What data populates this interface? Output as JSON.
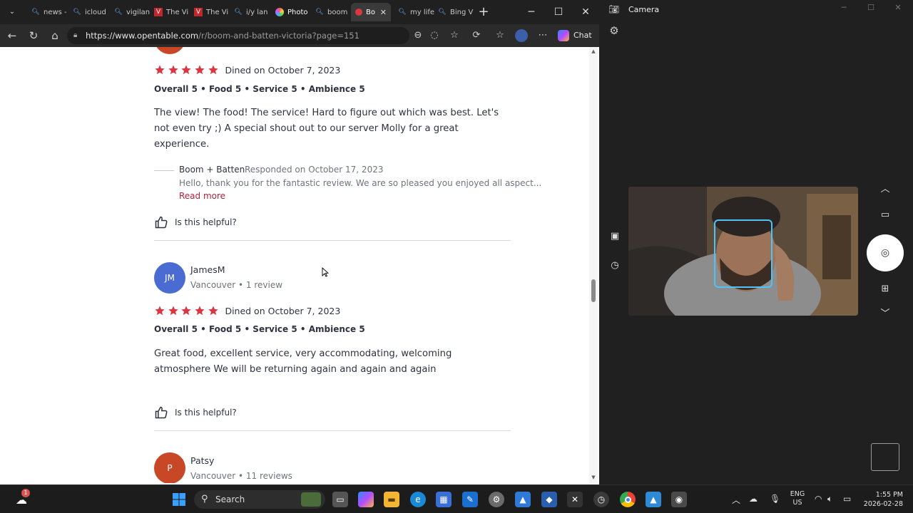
{
  "browser": {
    "tabs": [
      {
        "label": "news -"
      },
      {
        "label": "icloud"
      },
      {
        "label": "vigilan"
      },
      {
        "label": "The Vi"
      },
      {
        "label": "The Vi"
      },
      {
        "label": "i/y lan"
      },
      {
        "label": "Photo"
      },
      {
        "label": "boom"
      },
      {
        "label": "Bo",
        "active": true
      },
      {
        "label": "my life"
      },
      {
        "label": "Bing V"
      }
    ],
    "new_tab": "+",
    "url_host": "https://www.opentable.com",
    "url_path": "/r/boom-and-batten-victoria?page=151",
    "chat_label": "Chat"
  },
  "reviews": [
    {
      "dined": "Dined on October 7, 2023",
      "ratings": "Overall 5 • Food 5 • Service 5 • Ambience 5",
      "text": "The view! The food! The service! Hard to figure out which was best. Let's not even try ;) A special shout out to our server Molly for a great experience.",
      "response": {
        "name": "Boom + Batten",
        "date": "Responded on October 17, 2023",
        "text": "Hello, thank you for the fantastic review. We are so pleased you enjoyed all aspect...",
        "read_more": "Read more"
      },
      "helpful": "Is this helpful?"
    },
    {
      "initials": "JM",
      "name": "JamesM",
      "location": "Vancouver • 1 review",
      "avatar_color": "#4a6bd1",
      "dined": "Dined on October 7, 2023",
      "ratings": "Overall 5 • Food 5 • Service 5 • Ambience 5",
      "text": "Great food, excellent service, very accommodating, welcoming atmosphere We will be returning again and again and again",
      "helpful": "Is this helpful?"
    },
    {
      "initials": "P",
      "name": "Patsy",
      "location": "Vancouver • 11 reviews",
      "avatar_color": "#c74726"
    }
  ],
  "camera": {
    "title": "Camera"
  },
  "taskbar": {
    "search": "Search",
    "lang_line1": "ENG",
    "lang_line2": "US",
    "time": "1:55 PM",
    "date": "2026-02-28",
    "notification_badge": "1"
  },
  "colors": {
    "star": "#da3743",
    "link": "#b0213d"
  }
}
